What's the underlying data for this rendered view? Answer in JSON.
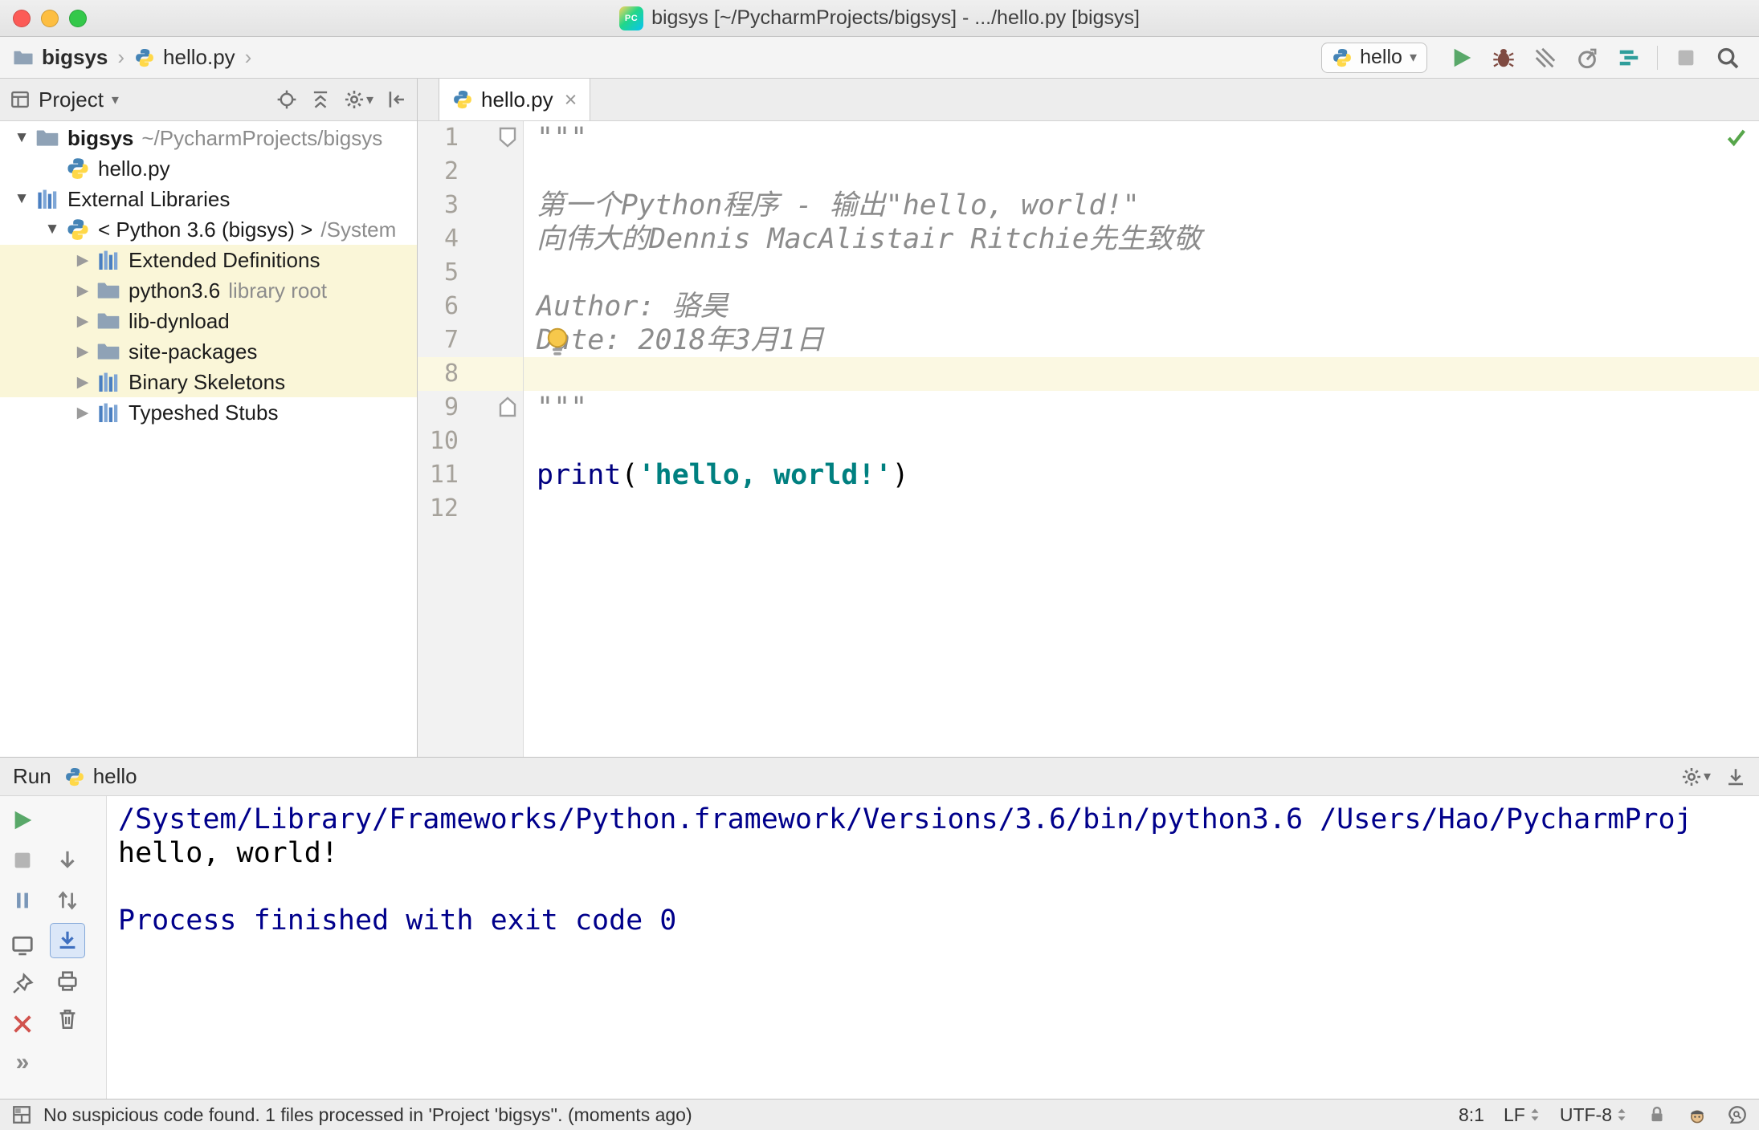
{
  "glyphs": {
    "expanded": "▼",
    "collapsed": "▶",
    "crumb_sep": "›",
    "caret_down": "▾",
    "close": "×",
    "hide_chevrons": "»"
  },
  "titlebar": {
    "app_icon": "PC",
    "title": "bigsys [~/PycharmProjects/bigsys] - .../hello.py [bigsys]"
  },
  "navbar": {
    "crumb_project": "bigsys",
    "crumb_file": "hello.py",
    "run_config": "hello"
  },
  "project": {
    "header": "Project",
    "tree": [
      {
        "name": "bigsys",
        "suffix": "~/PycharmProjects/bigsys"
      },
      {
        "name": "hello.py"
      },
      {
        "name": "External Libraries"
      },
      {
        "name": "< Python 3.6 (bigsys) >",
        "suffix": "/System"
      },
      {
        "name": "Extended Definitions"
      },
      {
        "name": "python3.6",
        "suffix": "library root"
      },
      {
        "name": "lib-dynload"
      },
      {
        "name": "site-packages"
      },
      {
        "name": "Binary Skeletons"
      },
      {
        "name": "Typeshed Stubs"
      }
    ]
  },
  "editor": {
    "tab": "hello.py",
    "line_numbers": [
      "1",
      "2",
      "3",
      "4",
      "5",
      "6",
      "7",
      "8",
      "9",
      "10",
      "11",
      "12"
    ],
    "doc": {
      "l1": "\"\"\"",
      "l3": "第一个Python程序 - 输出\"hello, world!\"",
      "l4": "向伟大的Dennis MacAlistair Ritchie先生致敬",
      "l6": "Author: 骆昊",
      "l7": "Date: 2018年3月1日",
      "l9": "\"\"\""
    },
    "code": {
      "print_fn": "print",
      "paren_open": "(",
      "string": "'hello, world!'",
      "paren_close": ")"
    }
  },
  "run": {
    "title": "Run",
    "config": "hello",
    "console": [
      "/System/Library/Frameworks/Python.framework/Versions/3.6/bin/python3.6 /Users/Hao/PycharmProj",
      "hello, world!",
      "",
      "Process finished with exit code 0"
    ]
  },
  "statusbar": {
    "message": "No suspicious code found. 1 files processed in 'Project 'bigsys''. (moments ago)",
    "position": "8:1",
    "line_ending": "LF",
    "encoding": "UTF-8"
  }
}
